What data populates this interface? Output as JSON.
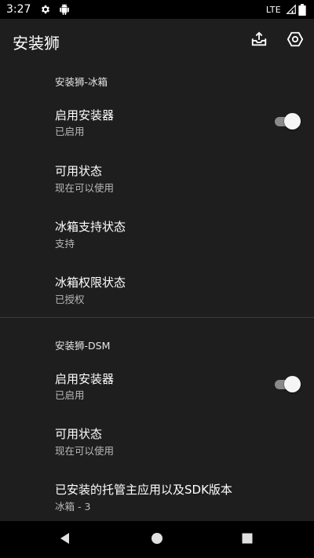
{
  "status_bar": {
    "time": "3:27",
    "left_icons": [
      "gear-icon",
      "android-icon"
    ],
    "network": "LTE",
    "right_icons": [
      "signal-icon",
      "battery-icon"
    ]
  },
  "app_bar": {
    "title": "安装狮",
    "actions": [
      "export-icon",
      "settings-icon"
    ]
  },
  "sections": [
    {
      "header": "安装狮-冰箱",
      "items": [
        {
          "title": "启用安装器",
          "summary": "已启用",
          "toggle": true
        },
        {
          "title": "可用状态",
          "summary": "现在可以使用"
        },
        {
          "title": "冰箱支持状态",
          "summary": "支持"
        },
        {
          "title": "冰箱权限状态",
          "summary": "已授权"
        }
      ]
    },
    {
      "header": "安装狮-DSM",
      "items": [
        {
          "title": "启用安装器",
          "summary": "已启用",
          "toggle": true
        },
        {
          "title": "可用状态",
          "summary": "现在可以使用"
        },
        {
          "title": "已安装的托管主应用以及SDK版本",
          "summary": "冰箱 - 3"
        }
      ]
    }
  ],
  "nav_bar": {
    "buttons": [
      "back-icon",
      "home-icon",
      "recents-icon"
    ]
  },
  "colors": {
    "background": "#1e1e1e",
    "bars": "#000000",
    "summary_text": "#b9b9b9",
    "toggle_track": "#8a8a8a",
    "toggle_thumb": "#f5f5f5"
  }
}
